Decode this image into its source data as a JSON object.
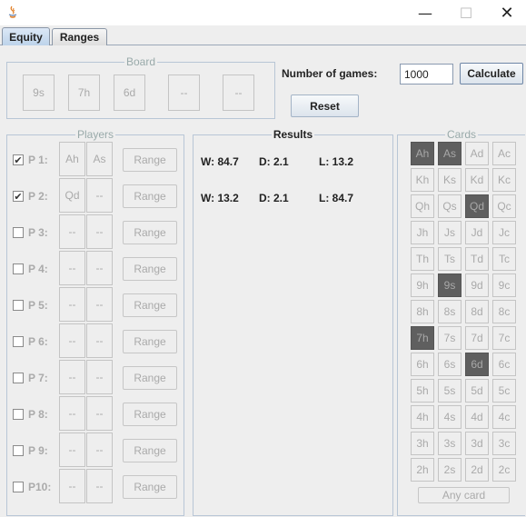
{
  "window": {
    "minimize_glyph": "—",
    "maximize_glyph": "☐",
    "close_glyph": "✕"
  },
  "tabs": [
    {
      "label": "Equity",
      "active": true
    },
    {
      "label": "Ranges",
      "active": false
    }
  ],
  "board": {
    "title": "Board",
    "cards": [
      "9s",
      "7h",
      "6d",
      "--",
      "--"
    ]
  },
  "controls": {
    "games_label": "Number of games:",
    "games_value": "1000",
    "calculate_label": "Calculate",
    "reset_label": "Reset"
  },
  "players": {
    "title": "Players",
    "range_label": "Range",
    "rows": [
      {
        "label": "P 1:",
        "checked": true,
        "card1": "Ah",
        "card2": "As"
      },
      {
        "label": "P 2:",
        "checked": true,
        "card1": "Qd",
        "card2": "--"
      },
      {
        "label": "P 3:",
        "checked": false,
        "card1": "--",
        "card2": "--"
      },
      {
        "label": "P 4:",
        "checked": false,
        "card1": "--",
        "card2": "--"
      },
      {
        "label": "P 5:",
        "checked": false,
        "card1": "--",
        "card2": "--"
      },
      {
        "label": "P 6:",
        "checked": false,
        "card1": "--",
        "card2": "--"
      },
      {
        "label": "P 7:",
        "checked": false,
        "card1": "--",
        "card2": "--"
      },
      {
        "label": "P 8:",
        "checked": false,
        "card1": "--",
        "card2": "--"
      },
      {
        "label": "P 9:",
        "checked": false,
        "card1": "--",
        "card2": "--"
      },
      {
        "label": "P10:",
        "checked": false,
        "card1": "--",
        "card2": "--"
      }
    ]
  },
  "results": {
    "title": "Results",
    "rows": [
      {
        "w": "W: 84.7",
        "d": "D: 2.1",
        "l": "L: 13.2"
      },
      {
        "w": "W: 13.2",
        "d": "D: 2.1",
        "l": "L: 84.7"
      }
    ]
  },
  "cards": {
    "title": "Cards",
    "any_card_label": "Any card",
    "rows": [
      [
        "Ah",
        "As",
        "Ad",
        "Ac"
      ],
      [
        "Kh",
        "Ks",
        "Kd",
        "Kc"
      ],
      [
        "Qh",
        "Qs",
        "Qd",
        "Qc"
      ],
      [
        "Jh",
        "Js",
        "Jd",
        "Jc"
      ],
      [
        "Th",
        "Ts",
        "Td",
        "Tc"
      ],
      [
        "9h",
        "9s",
        "9d",
        "9c"
      ],
      [
        "8h",
        "8s",
        "8d",
        "8c"
      ],
      [
        "7h",
        "7s",
        "7d",
        "7c"
      ],
      [
        "6h",
        "6s",
        "6d",
        "6c"
      ],
      [
        "5h",
        "5s",
        "5d",
        "5c"
      ],
      [
        "4h",
        "4s",
        "4d",
        "4c"
      ],
      [
        "3h",
        "3s",
        "3d",
        "3c"
      ],
      [
        "2h",
        "2s",
        "2d",
        "2c"
      ]
    ],
    "used": [
      "Ah",
      "As",
      "Qd",
      "9s",
      "7h",
      "6d"
    ]
  }
}
